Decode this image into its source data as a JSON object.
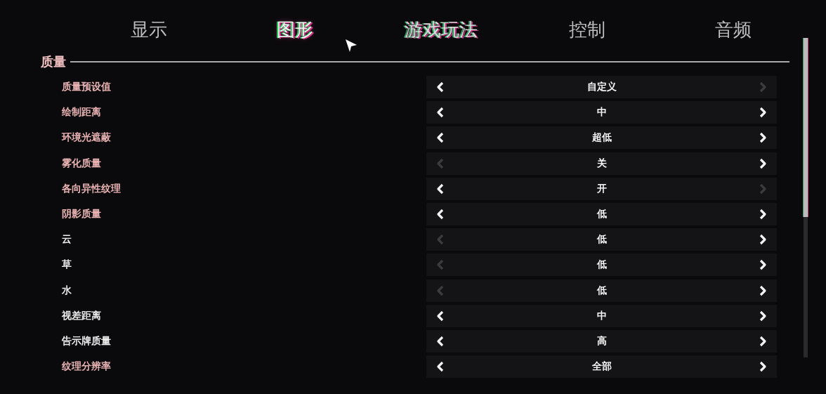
{
  "tabs": [
    {
      "label": "显示",
      "selected": false,
      "hovered": false
    },
    {
      "label": "图形",
      "selected": true,
      "hovered": false
    },
    {
      "label": "游戏玩法",
      "selected": false,
      "hovered": true
    },
    {
      "label": "控制",
      "selected": false,
      "hovered": false
    },
    {
      "label": "音频",
      "selected": false,
      "hovered": false
    }
  ],
  "section": {
    "title": "质量"
  },
  "settings": [
    {
      "label": "质量预设值",
      "modified": true,
      "value": "自定义",
      "prev_enabled": true,
      "next_enabled": false
    },
    {
      "label": "绘制距离",
      "modified": true,
      "value": "中",
      "prev_enabled": true,
      "next_enabled": true
    },
    {
      "label": "环境光遮蔽",
      "modified": true,
      "value": "超低",
      "prev_enabled": true,
      "next_enabled": true
    },
    {
      "label": "雾化质量",
      "modified": true,
      "value": "关",
      "prev_enabled": false,
      "next_enabled": true
    },
    {
      "label": "各向异性纹理",
      "modified": true,
      "value": "开",
      "prev_enabled": true,
      "next_enabled": false
    },
    {
      "label": "阴影质量",
      "modified": true,
      "value": "低",
      "prev_enabled": true,
      "next_enabled": true
    },
    {
      "label": "云",
      "modified": false,
      "value": "低",
      "prev_enabled": false,
      "next_enabled": true
    },
    {
      "label": "草",
      "modified": false,
      "value": "低",
      "prev_enabled": false,
      "next_enabled": true
    },
    {
      "label": "水",
      "modified": false,
      "value": "低",
      "prev_enabled": false,
      "next_enabled": true
    },
    {
      "label": "视差距离",
      "modified": false,
      "value": "中",
      "prev_enabled": true,
      "next_enabled": true
    },
    {
      "label": "告示牌质量",
      "modified": false,
      "value": "高",
      "prev_enabled": true,
      "next_enabled": true
    },
    {
      "label": "纹理分辨率",
      "modified": true,
      "value": "全部",
      "prev_enabled": true,
      "next_enabled": true
    }
  ]
}
